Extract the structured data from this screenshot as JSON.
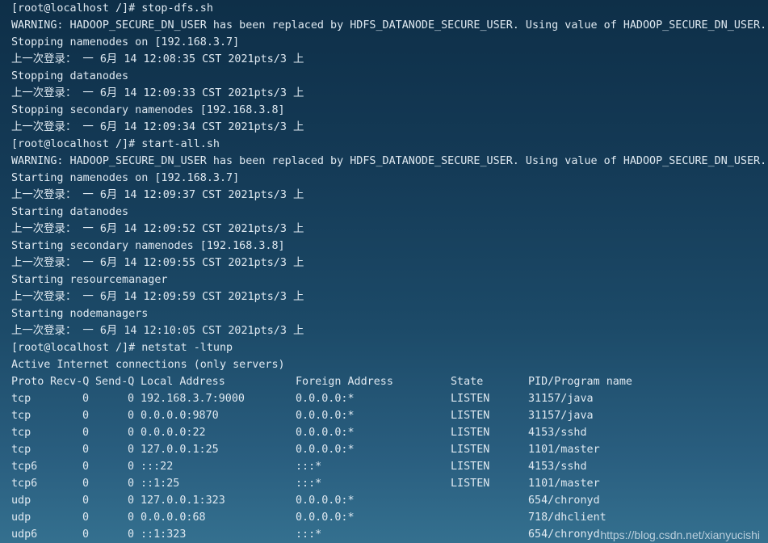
{
  "terminal": {
    "lines": [
      "[root@localhost /]# stop-dfs.sh",
      "WARNING: HADOOP_SECURE_DN_USER has been replaced by HDFS_DATANODE_SECURE_USER. Using value of HADOOP_SECURE_DN_USER.",
      "Stopping namenodes on [192.168.3.7]",
      "上一次登录： 一 6月 14 12:08:35 CST 2021pts/3 上",
      "Stopping datanodes",
      "上一次登录： 一 6月 14 12:09:33 CST 2021pts/3 上",
      "Stopping secondary namenodes [192.168.3.8]",
      "上一次登录： 一 6月 14 12:09:34 CST 2021pts/3 上",
      "[root@localhost /]# start-all.sh",
      "WARNING: HADOOP_SECURE_DN_USER has been replaced by HDFS_DATANODE_SECURE_USER. Using value of HADOOP_SECURE_DN_USER.",
      "Starting namenodes on [192.168.3.7]",
      "上一次登录： 一 6月 14 12:09:37 CST 2021pts/3 上",
      "Starting datanodes",
      "上一次登录： 一 6月 14 12:09:52 CST 2021pts/3 上",
      "Starting secondary namenodes [192.168.3.8]",
      "上一次登录： 一 6月 14 12:09:55 CST 2021pts/3 上",
      "Starting resourcemanager",
      "上一次登录： 一 6月 14 12:09:59 CST 2021pts/3 上",
      "Starting nodemanagers",
      "上一次登录： 一 6月 14 12:10:05 CST 2021pts/3 上",
      "[root@localhost /]# netstat -ltunp",
      "Active Internet connections (only servers)"
    ],
    "netstat": {
      "headers": [
        "Proto",
        "Recv-Q",
        "Send-Q",
        "Local Address",
        "Foreign Address",
        "State",
        "PID/Program name"
      ],
      "rows": [
        [
          "tcp",
          "0",
          "0",
          "192.168.3.7:9000",
          "0.0.0.0:*",
          "LISTEN",
          "31157/java"
        ],
        [
          "tcp",
          "0",
          "0",
          "0.0.0.0:9870",
          "0.0.0.0:*",
          "LISTEN",
          "31157/java"
        ],
        [
          "tcp",
          "0",
          "0",
          "0.0.0.0:22",
          "0.0.0.0:*",
          "LISTEN",
          "4153/sshd"
        ],
        [
          "tcp",
          "0",
          "0",
          "127.0.0.1:25",
          "0.0.0.0:*",
          "LISTEN",
          "1101/master"
        ],
        [
          "tcp6",
          "0",
          "0",
          ":::22",
          ":::*",
          "LISTEN",
          "4153/sshd"
        ],
        [
          "tcp6",
          "0",
          "0",
          "::1:25",
          ":::*",
          "LISTEN",
          "1101/master"
        ],
        [
          "udp",
          "0",
          "0",
          "127.0.0.1:323",
          "0.0.0.0:*",
          "",
          "654/chronyd"
        ],
        [
          "udp",
          "0",
          "0",
          "0.0.0.0:68",
          "0.0.0.0:*",
          "",
          "718/dhclient"
        ],
        [
          "udp6",
          "0",
          "0",
          "::1:323",
          ":::*",
          "",
          "654/chronyd"
        ]
      ]
    }
  },
  "watermark": "https://blog.csdn.net/xianyucishi",
  "colors": {
    "text": "#dfe9f1",
    "background_top": "#0e2f48",
    "background_bottom": "#34708f"
  }
}
